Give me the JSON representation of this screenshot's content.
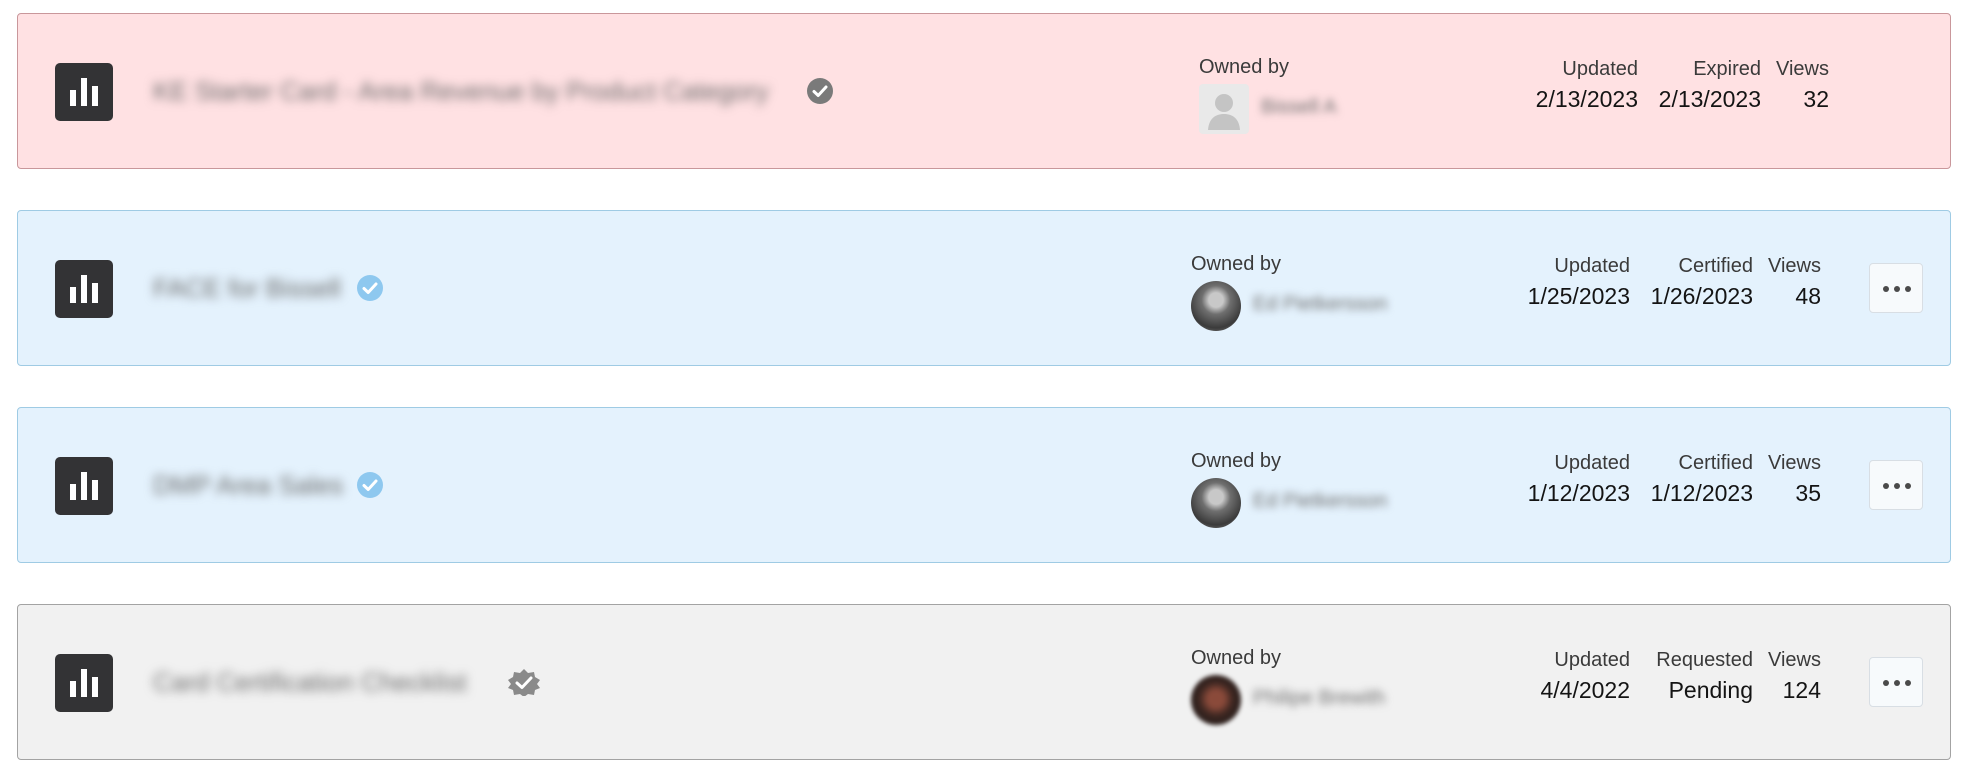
{
  "cards": [
    {
      "variant": "expired",
      "title": "KE Starter Card - Area Revenue by Product Category",
      "badge_icon": "check-circle-icon",
      "badge_color": "#7a7a7a",
      "owner_label": "Owned by",
      "owner_name": "Bissell A",
      "owner_avatar": "person-placeholder-icon",
      "updated_label": "Updated",
      "updated_value": "2/13/2023",
      "status_label": "Expired",
      "status_value": "2/13/2023",
      "views_label": "Views",
      "views_value": "32",
      "has_menu": false
    },
    {
      "variant": "certified",
      "title": "FACE for Bissell",
      "badge_icon": "check-circle-icon",
      "badge_color": "#8ec8ef",
      "owner_label": "Owned by",
      "owner_name": "Ed Pietkersson",
      "owner_avatar": "user-photo",
      "updated_label": "Updated",
      "updated_value": "1/25/2023",
      "status_label": "Certified",
      "status_value": "1/26/2023",
      "views_label": "Views",
      "views_value": "48",
      "has_menu": true
    },
    {
      "variant": "certified",
      "title": "DMP Area Sales",
      "badge_icon": "check-circle-icon",
      "badge_color": "#8ec8ef",
      "owner_label": "Owned by",
      "owner_name": "Ed Pietkersson",
      "owner_avatar": "user-photo",
      "updated_label": "Updated",
      "updated_value": "1/12/2023",
      "status_label": "Certified",
      "status_value": "1/12/2023",
      "views_label": "Views",
      "views_value": "35",
      "has_menu": true
    },
    {
      "variant": "pending",
      "title": "Card Certification Checklist",
      "badge_icon": "certification-seal-icon",
      "badge_color": "#8a8a8a",
      "owner_label": "Owned by",
      "owner_name": "Philipe Brewith",
      "owner_avatar": "user-photo",
      "updated_label": "Updated",
      "updated_value": "4/4/2022",
      "status_label": "Requested",
      "status_value": "Pending",
      "views_label": "Views",
      "views_value": "124",
      "has_menu": true
    }
  ],
  "menu_icon": "more-horizontal-icon",
  "card_type_icon": "bar-chart-icon"
}
